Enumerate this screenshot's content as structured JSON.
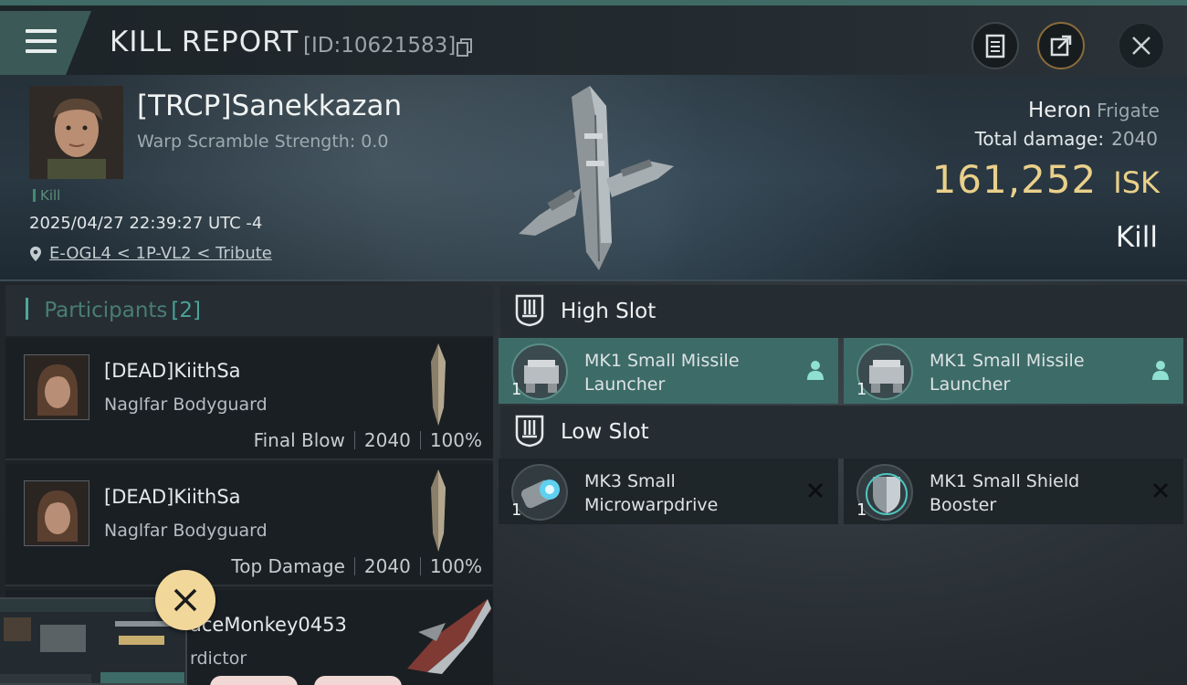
{
  "header": {
    "title": "KILL REPORT",
    "report_id": "[ID:10621583]"
  },
  "victim": {
    "name": "[TRCP]Sanekkazan",
    "warp_scramble": "Warp Scramble Strength: 0.0",
    "tag": "Kill",
    "datetime": "2025/04/27 22:39:27 UTC -4",
    "location": "E-OGL4 < 1P-VL2 < Tribute",
    "ship": "Heron",
    "ship_class": "Frigate",
    "total_damage_label": "Total damage:",
    "total_damage": "2040",
    "isk_value": "161,252",
    "isk_unit": "ISK",
    "result": "Kill"
  },
  "participants": {
    "title": "Participants",
    "count": "[2]",
    "rows": [
      {
        "name": "[DEAD]KiithSa",
        "ship": "Naglfar Bodyguard",
        "role": "Final Blow",
        "damage": "2040",
        "percent": "100%"
      },
      {
        "name": "[DEAD]KiithSa",
        "ship": "Naglfar Bodyguard",
        "role": "Top Damage",
        "damage": "2040",
        "percent": "100%"
      },
      {
        "name": "aceMonkey0453",
        "ship": "rdictor"
      }
    ]
  },
  "fitting": {
    "high_slot": {
      "label": "High Slot",
      "modules": [
        {
          "name": "MK1 Small Missile Launcher",
          "qty": "1",
          "icon": "missile-launcher-icon"
        },
        {
          "name": "MK1 Small Missile Launcher",
          "qty": "1",
          "icon": "missile-launcher-icon"
        }
      ]
    },
    "low_slot": {
      "label": "Low Slot",
      "modules": [
        {
          "name": "MK3 Small Microwarpdrive",
          "qty": "1",
          "icon": "microwarpdrive-icon"
        },
        {
          "name": "MK1 Small Shield Booster",
          "qty": "1",
          "icon": "shield-booster-icon"
        }
      ]
    }
  },
  "colors": {
    "accent_teal": "#3d6b68",
    "isk_gold": "#ead08a",
    "float_button": "#f2d79a"
  }
}
